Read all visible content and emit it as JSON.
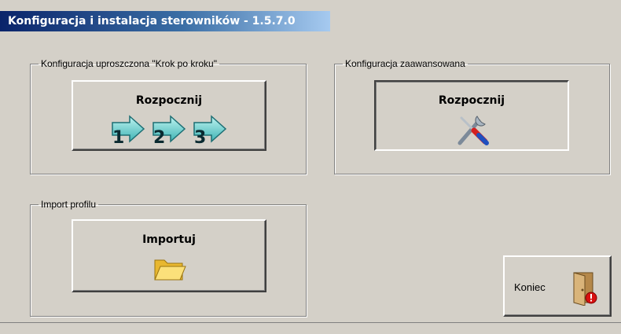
{
  "window": {
    "title": "Konfiguracja i instalacja sterowników - 1.5.7.0"
  },
  "groups": {
    "simple": {
      "legend": "Konfiguracja uproszczona \"Krok po kroku\"",
      "button_label": "Rozpocznij",
      "steps": [
        "1",
        "2",
        "3"
      ]
    },
    "advanced": {
      "legend": "Konfiguracja zaawansowana",
      "button_label": "Rozpocznij"
    },
    "import": {
      "legend": "Import profilu",
      "button_label": "Importuj"
    }
  },
  "exit": {
    "label": "Koniec"
  },
  "icons": {
    "steps": "arrow-steps-icon",
    "tools": "screwdriver-wrench-icon",
    "folder": "open-folder-icon",
    "exit": "door-exit-icon"
  },
  "colors": {
    "titlebar_start": "#0a246a",
    "titlebar_end": "#a6caf0",
    "face": "#d4d0c8"
  }
}
